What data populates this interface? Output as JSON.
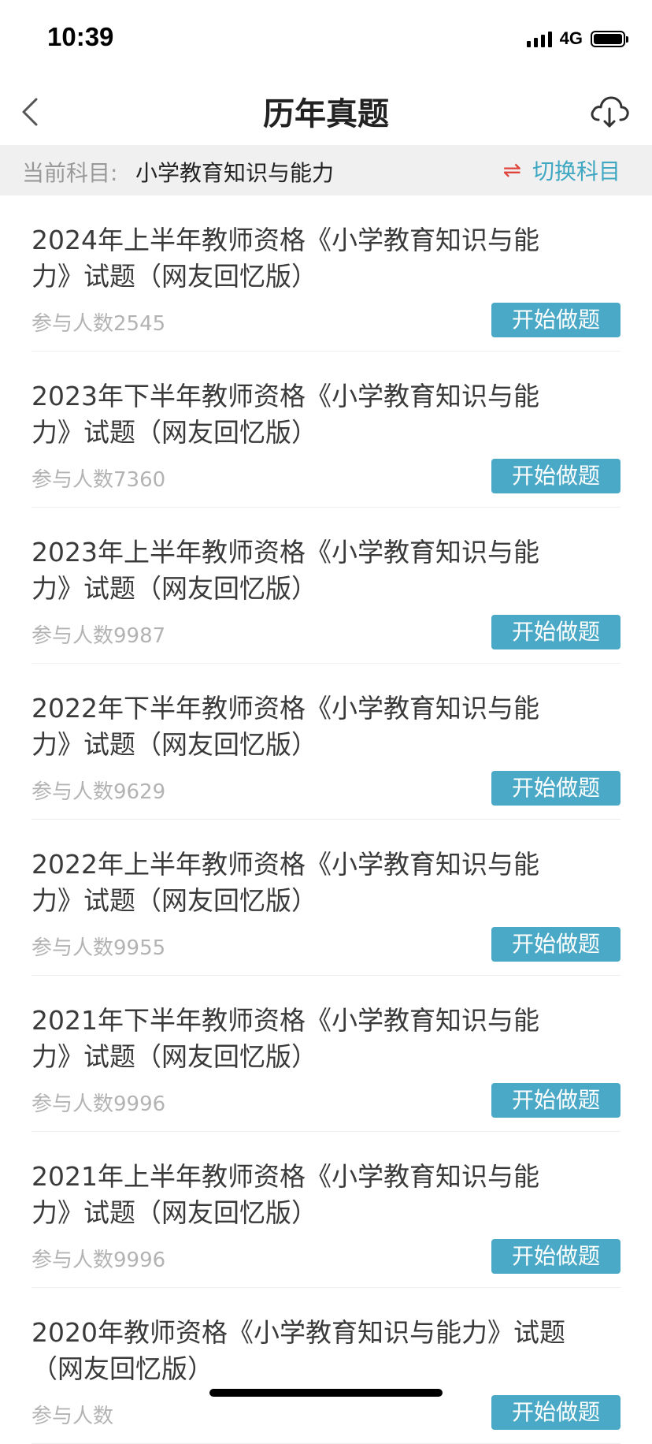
{
  "status": {
    "time": "10:39",
    "network": "4G"
  },
  "nav": {
    "title": "历年真题",
    "back_icon": "chevron-left-icon",
    "download_icon": "cloud-download-icon"
  },
  "subject": {
    "prefix": "当前科目:",
    "name": "小学教育知识与能力",
    "switch_icon": "⇌",
    "switch_label": "切换科目"
  },
  "start_label": "开始做题",
  "items": [
    {
      "title": "2024年上半年教师资格《小学教育知识与能力》试题（网友回忆版）",
      "count": "参与人数2545"
    },
    {
      "title": "2023年下半年教师资格《小学教育知识与能力》试题（网友回忆版）",
      "count": "参与人数7360"
    },
    {
      "title": "2023年上半年教师资格《小学教育知识与能力》试题（网友回忆版）",
      "count": "参与人数9987"
    },
    {
      "title": "2022年下半年教师资格《小学教育知识与能力》试题（网友回忆版）",
      "count": "参与人数9629"
    },
    {
      "title": "2022年上半年教师资格《小学教育知识与能力》试题（网友回忆版）",
      "count": "参与人数9955"
    },
    {
      "title": "2021年下半年教师资格《小学教育知识与能力》试题（网友回忆版）",
      "count": "参与人数9996"
    },
    {
      "title": "2021年上半年教师资格《小学教育知识与能力》试题（网友回忆版）",
      "count": "参与人数9996"
    },
    {
      "title": "2020年教师资格《小学教育知识与能力》试题（网友回忆版）",
      "count": "参与人数"
    }
  ]
}
